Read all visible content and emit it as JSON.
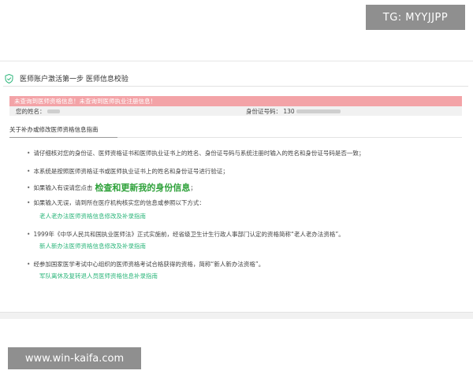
{
  "watermarks": {
    "top": "TG: MYYJJPP",
    "bottom": "www.win-kaifa.com"
  },
  "header": {
    "title": "医师账户激活第一步 医师信息校验"
  },
  "alert": {
    "error": "未查询到医师资格信息！未查询到医师执业注册信息！"
  },
  "info": {
    "name_label": "您的姓名：",
    "id_label": "身份证号码：",
    "id_value": "130"
  },
  "guide": {
    "title": "关于补办或修改医师资格信息指南",
    "items": [
      "请仔细核对您的身份证、医师资格证书和医师执业证书上的姓名、身份证号码与系统注册时输入的姓名和身份证号码是否一致；",
      "本系统是按照医师资格证书或医师执业证书上的姓名和身份证号进行验证；",
      "如果输入有误请您点击",
      "如果输入无误，请到所在医疗机构核实您的信息或参照以下方式：",
      "1999年《中华人民共和国执业医师法》正式实施前，经省级卫生计生行政人事部门认定的资格简称“老人老办法资格”。",
      "经参加国家医学考试中心组织的医师资格考试合格获得的资格，简称“新人新办法资格”。"
    ],
    "recheck_link": "检查和更新我的身份信息",
    "recheck_suffix": "；",
    "links": [
      "老人老办法医师资格信息修改及补录指南",
      "新人新办法医师资格信息修改及补录指南",
      "军队离休及复转退人员医师资格信息补录指南"
    ]
  },
  "colors": {
    "alert_bg": "#f3a3a7",
    "link": "#2bb57a",
    "highlight": "#2ea13a"
  }
}
